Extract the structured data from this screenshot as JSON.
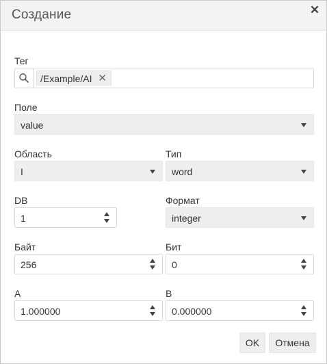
{
  "dialog": {
    "title": "Создание",
    "close_glyph": "✕"
  },
  "tag": {
    "label": "Тег",
    "chip": "/Example/AI",
    "remove_glyph": "✕"
  },
  "field": {
    "label": "Поле",
    "value": "value"
  },
  "area": {
    "label": "Область",
    "value": "I"
  },
  "type": {
    "label": "Тип",
    "value": "word"
  },
  "db": {
    "label": "DB",
    "value": "1"
  },
  "format": {
    "label": "Формат",
    "value": "integer"
  },
  "byte": {
    "label": "Байт",
    "value": "256"
  },
  "bit": {
    "label": "Бит",
    "value": "0"
  },
  "a": {
    "label": "A",
    "value": "1.000000"
  },
  "b": {
    "label": "B",
    "value": "0.000000"
  },
  "buttons": {
    "ok": "OK",
    "cancel": "Отмена"
  }
}
